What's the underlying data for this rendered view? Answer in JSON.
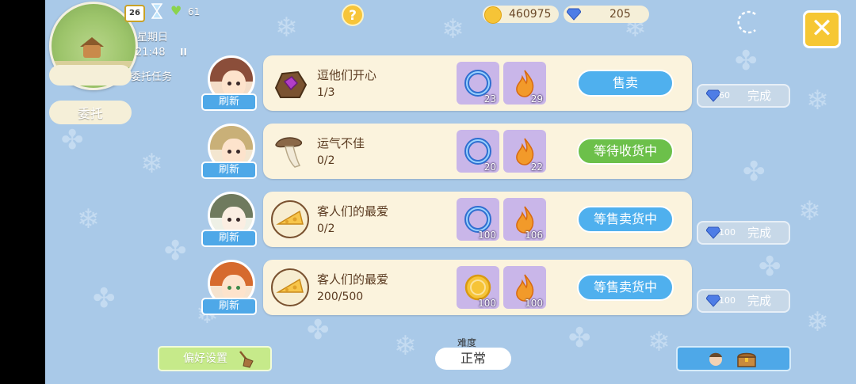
{
  "hud": {
    "calendar_day": "26",
    "stamina": "61",
    "weekday": "星期日",
    "time": "21:48",
    "pause_symbol": "II",
    "task_label": "委托任务",
    "commission_button": "委托",
    "help_symbol": "?",
    "coins": "460975",
    "diamonds": "205",
    "close_symbol": "✕"
  },
  "orders": [
    {
      "item": "逗他们开心",
      "progress": "1/3",
      "item_icon": "gem-ore-icon",
      "rewards": [
        {
          "icon": "blue-ring-icon",
          "value": "23"
        },
        {
          "icon": "flame-icon",
          "value": "29"
        }
      ],
      "action": "售卖",
      "action_style": "blue",
      "done": {
        "gems": "60",
        "label": "完成"
      }
    },
    {
      "item": "运气不佳",
      "progress": "0/2",
      "item_icon": "mushroom-icon",
      "rewards": [
        {
          "icon": "blue-ring-icon",
          "value": "20"
        },
        {
          "icon": "flame-icon",
          "value": "22"
        }
      ],
      "action": "等待收货中",
      "action_style": "green",
      "done": null
    },
    {
      "item": "客人们的最爱",
      "progress": "0/2",
      "item_icon": "cheese-icon",
      "rewards": [
        {
          "icon": "blue-ring-icon",
          "value": "100"
        },
        {
          "icon": "flame-icon",
          "value": "106"
        }
      ],
      "action": "等售卖货中",
      "action_style": "blue",
      "done": {
        "gems": "100",
        "label": "完成"
      }
    },
    {
      "item": "客人们的最爱",
      "progress": "200/500",
      "item_icon": "cheese-icon",
      "rewards": [
        {
          "icon": "gold-coin-icon",
          "value": "100"
        },
        {
          "icon": "flame-icon",
          "value": "100"
        }
      ],
      "action": "等售卖货中",
      "action_style": "blue",
      "done": {
        "gems": "100",
        "label": "完成"
      }
    }
  ],
  "refresh_label": "刷新",
  "footer": {
    "preference_button": "偏好设置",
    "difficulty_label": "难度",
    "difficulty_value": "正常"
  },
  "colors": {
    "background": "#a9c9e8",
    "card": "#fbf3dd",
    "accent_blue": "#4fb0ee",
    "accent_green": "#6cc04a",
    "reward_tile": "#c9b6e9"
  }
}
